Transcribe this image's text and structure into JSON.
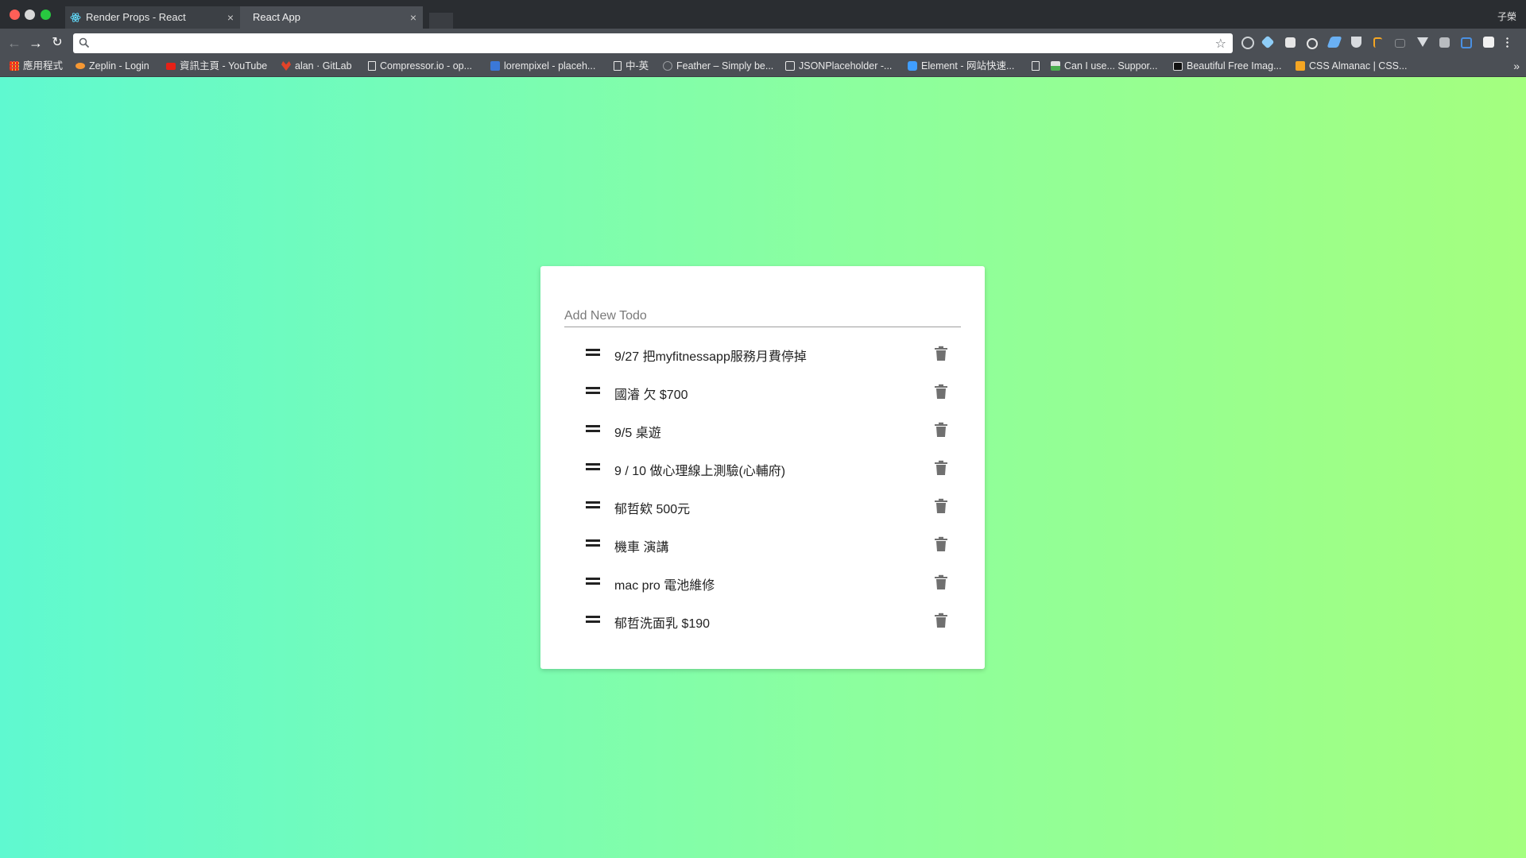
{
  "browser": {
    "tabs": [
      {
        "label": "Render Props - React",
        "close": "×",
        "icon": "react-icon",
        "active": false
      },
      {
        "label": "React App",
        "close": "×",
        "active": true
      }
    ],
    "profile_name": "子榮",
    "address": {
      "value": "",
      "placeholder": ""
    },
    "bookmarks": [
      {
        "label": "應用程式",
        "icon": "apps-icon"
      },
      {
        "label": "Zeplin - Login",
        "icon": "zeplin-icon"
      },
      {
        "label": "資訊主頁 - YouTube",
        "icon": "youtube-icon"
      },
      {
        "label": "alan · GitLab",
        "icon": "gitlab-icon"
      },
      {
        "label": "Compressor.io - op...",
        "icon": "page-icon"
      },
      {
        "label": "lorempixel - placeh...",
        "icon": "lorempixel-icon"
      },
      {
        "label": "中-英",
        "icon": "page-icon"
      },
      {
        "label": "Feather – Simply be...",
        "icon": "feather-icon"
      },
      {
        "label": "JSONPlaceholder -...",
        "icon": "json-icon"
      },
      {
        "label": "Element - 网站快速...",
        "icon": "element-icon"
      },
      {
        "label": "",
        "icon": "page-icon"
      },
      {
        "label": "Can I use... Suppor...",
        "icon": "caniuse-icon"
      },
      {
        "label": "Beautiful Free Imag...",
        "icon": "camera-icon"
      },
      {
        "label": "CSS Almanac | CSS...",
        "icon": "css-almanac-icon"
      }
    ],
    "bookmarks_overflow": "»",
    "colors": {
      "tabbar": "#2a2d31",
      "toolbar": "#4b4f55"
    }
  },
  "app": {
    "new_todo_placeholder": "Add New Todo",
    "todos": [
      {
        "text": "9/27 把myfitnessapp服務月費停掉"
      },
      {
        "text": "國濬 欠 $700"
      },
      {
        "text": "9/5 桌遊"
      },
      {
        "text": "9 / 10 做心理線上測驗(心輔府)"
      },
      {
        "text": "郁哲欸 500元"
      },
      {
        "text": "機車 演講"
      },
      {
        "text": "mac pro 電池維修"
      },
      {
        "text": "郁哲洗面乳 $190"
      }
    ],
    "colors": {
      "gradient_start": "#5ff9d0",
      "gradient_end": "#a4ff7f",
      "card": "#ffffff"
    }
  }
}
